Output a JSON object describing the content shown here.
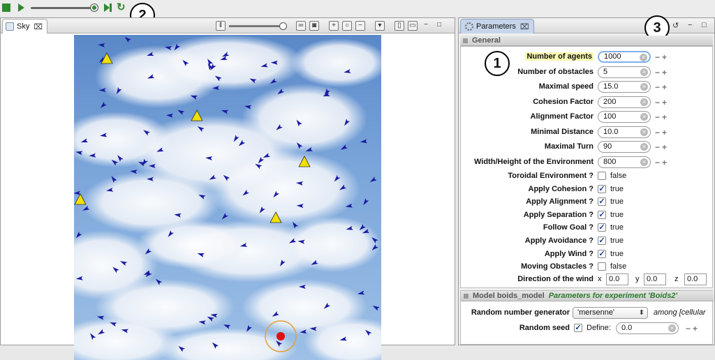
{
  "toolbar": {
    "callout": "2"
  },
  "sky_tab": {
    "title": "Sky",
    "close": "⌧"
  },
  "param_tab": {
    "title": "Parameters",
    "close": "⌧",
    "callout": "3"
  },
  "general": {
    "title": "General",
    "callout": "1",
    "fields": [
      {
        "label": "Number of agents",
        "value": "1000"
      },
      {
        "label": "Number of obstacles",
        "value": "5"
      },
      {
        "label": "Maximal speed",
        "value": "15.0"
      },
      {
        "label": "Cohesion Factor",
        "value": "200"
      },
      {
        "label": "Alignment Factor",
        "value": "100"
      },
      {
        "label": "Minimal Distance",
        "value": "10.0"
      },
      {
        "label": "Maximal Turn",
        "value": "90"
      },
      {
        "label": "Width/Height of the Environment",
        "value": "800"
      }
    ],
    "checks": [
      {
        "label": "Toroidal Environment ?",
        "value": "false",
        "checked": false
      },
      {
        "label": "Apply Cohesion ?",
        "value": "true",
        "checked": true
      },
      {
        "label": "Apply Alignment ?",
        "value": "true",
        "checked": true
      },
      {
        "label": "Apply Separation ?",
        "value": "true",
        "checked": true
      },
      {
        "label": "Follow Goal ?",
        "value": "true",
        "checked": true
      },
      {
        "label": "Apply Avoidance ?",
        "value": "true",
        "checked": true
      },
      {
        "label": "Apply Wind ?",
        "value": "true",
        "checked": true
      },
      {
        "label": "Moving Obstacles ?",
        "value": "false",
        "checked": false
      }
    ],
    "wind": {
      "label": "Direction of the wind",
      "x_label": "x",
      "x": "0.0",
      "y_label": "y",
      "y": "0.0",
      "z_label": "z",
      "z": "0.0"
    }
  },
  "model": {
    "title": "Model boids_model",
    "subtitle": "Parameters for experiment 'Boids2'",
    "rng_label": "Random number generator",
    "rng_value": "'mersenne'",
    "rng_suffix": "among [cellular",
    "seed_label": "Random seed",
    "seed_define": "Define:",
    "seed_value": "0.0"
  },
  "colors": {
    "accent_green": "#2f8a2f",
    "boid": "#1a1aa0",
    "obstacle": "#f2e000",
    "goal": "#e01010"
  }
}
